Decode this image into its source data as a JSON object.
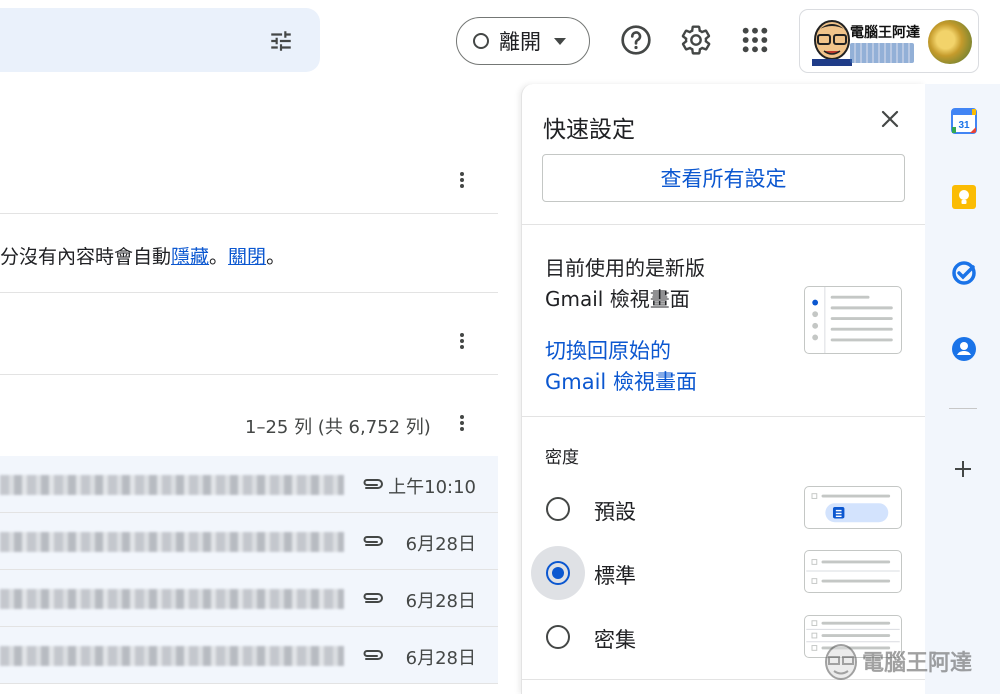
{
  "header": {
    "status_label": "離開",
    "brand_text": "電腦王阿達"
  },
  "main": {
    "notice_prefix": "分沒有內容時會自動",
    "notice_hide_link": "隱藏",
    "notice_sep": "。",
    "notice_close_link": "關閉",
    "notice_end": "。",
    "pager": "1–25 列 (共 6,752 列)",
    "mails": [
      {
        "date": "上午10:10"
      },
      {
        "date": "6月28日"
      },
      {
        "date": "6月28日"
      },
      {
        "date": "6月28日"
      }
    ]
  },
  "quick_settings": {
    "title": "快速設定",
    "see_all": "查看所有設定",
    "view_line1": "目前使用的是新版",
    "view_line2": "Gmail 檢視畫面",
    "switch_line1": "切換回原始的",
    "switch_line2": "Gmail 檢視畫面",
    "density_label": "密度",
    "density_options": [
      {
        "label": "預設",
        "selected": false
      },
      {
        "label": "標準",
        "selected": true
      },
      {
        "label": "密集",
        "selected": false
      }
    ]
  },
  "side_panel": {
    "calendar_day": "31"
  },
  "watermark": {
    "text": "電腦王阿達"
  },
  "colors": {
    "accent": "#0b57d0",
    "search_bg": "#eaf1fb",
    "selected_row_bg": "#f2f6fc"
  }
}
